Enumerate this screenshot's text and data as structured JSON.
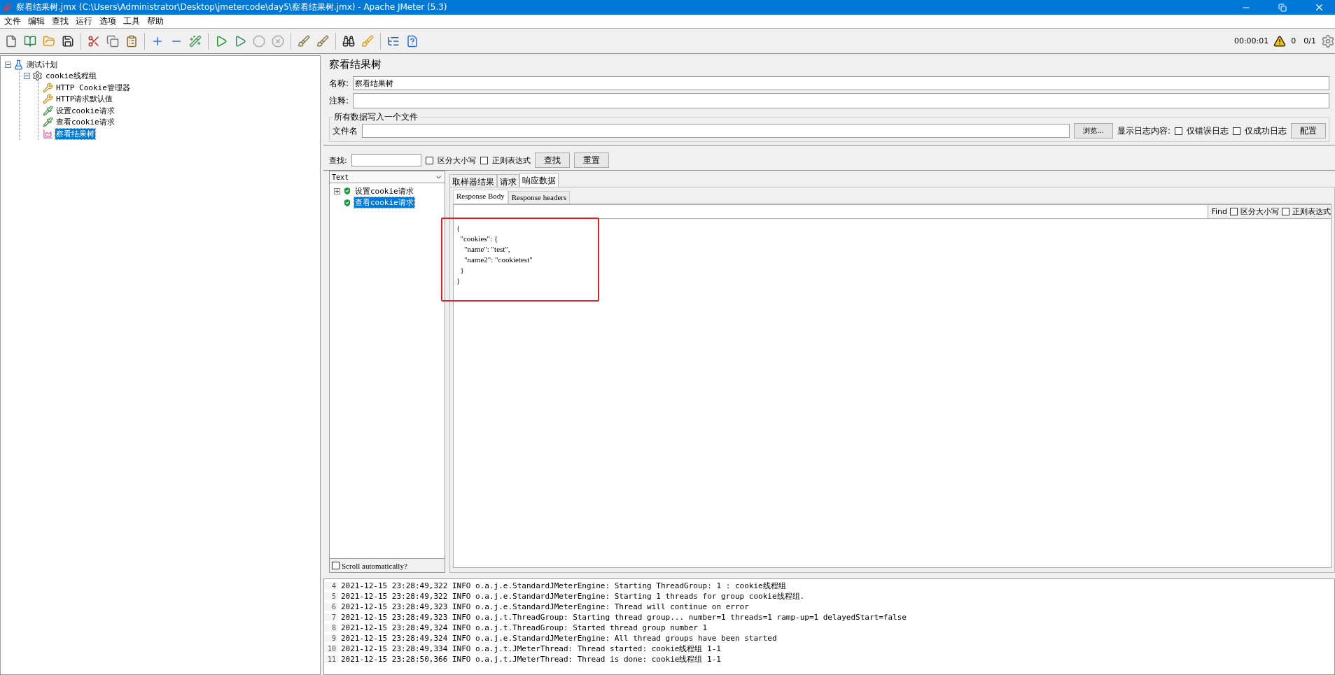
{
  "window": {
    "title": "察看结果树.jmx (C:\\Users\\Administrator\\Desktop\\jmetercode\\day5\\察看结果树.jmx) - Apache JMeter (5.3)"
  },
  "menu": [
    "文件",
    "编辑",
    "查找",
    "运行",
    "选项",
    "工具",
    "帮助"
  ],
  "status": {
    "elapsed": "00:00:01",
    "warnings": "0",
    "threads": "0/1"
  },
  "tree": [
    {
      "label": "测试计划",
      "kind": "plan",
      "expanded": true,
      "selected": false,
      "children": [
        {
          "label": "cookie线程组",
          "kind": "thread-group",
          "expanded": true,
          "selected": false,
          "children": [
            {
              "label": "HTTP Cookie管理器",
              "kind": "config",
              "selected": false
            },
            {
              "label": "HTTP请求默认值",
              "kind": "config",
              "selected": false
            },
            {
              "label": "设置cookie请求",
              "kind": "sampler",
              "selected": false
            },
            {
              "label": "查看cookie请求",
              "kind": "sampler",
              "selected": false
            },
            {
              "label": "察看结果树",
              "kind": "listener",
              "selected": true
            }
          ]
        }
      ]
    }
  ],
  "editor": {
    "title": "察看结果树",
    "name_label": "名称:",
    "name_value": "察看结果树",
    "comment_label": "注释:",
    "file_section": {
      "title": "所有数据写入一个文件",
      "file_label": "文件名",
      "browse_button": "浏览...",
      "log_label": "显示日志内容:",
      "options": [
        {
          "label": "仅错误日志",
          "checked": false
        },
        {
          "label": "仅成功日志",
          "checked": false
        }
      ],
      "config_button": "配置"
    },
    "search": {
      "label": "查找:",
      "options": [
        {
          "label": "区分大小写",
          "checked": false
        },
        {
          "label": "正则表达式",
          "checked": false
        }
      ],
      "find_button": "查找",
      "reset_button": "重置"
    }
  },
  "results": {
    "renderer": "Text",
    "samples": [
      {
        "label": "设置cookie请求",
        "kind": "group",
        "expanded": false,
        "selected": false
      },
      {
        "label": "查看cookie请求",
        "kind": "leaf",
        "selected": true
      }
    ],
    "scroll_automatically": {
      "label": "Scroll automatically?",
      "checked": false
    },
    "tabs": [
      {
        "label": "取样器结果",
        "selected": false
      },
      {
        "label": "请求",
        "selected": false
      },
      {
        "label": "响应数据",
        "selected": true
      }
    ],
    "subtabs": [
      {
        "label": "Response Body",
        "selected": true
      },
      {
        "label": "Response headers",
        "selected": false
      }
    ],
    "find": {
      "label": "Find",
      "options": [
        {
          "label": "区分大小写",
          "checked": false
        },
        {
          "label": "正则表达式",
          "checked": false
        }
      ]
    },
    "body": [
      "{",
      "  \"cookies\": {",
      "    \"name\": \"test\",",
      "    \"name2\": \"cookietest\"",
      "  }",
      "}"
    ]
  },
  "log": [
    {
      "number": "4",
      "text": "2021-12-15 23:28:49,322 INFO o.a.j.e.StandardJMeterEngine: Starting ThreadGroup: 1 : cookie线程组"
    },
    {
      "number": "5",
      "text": "2021-12-15 23:28:49,322 INFO o.a.j.e.StandardJMeterEngine: Starting 1 threads for group cookie线程组."
    },
    {
      "number": "6",
      "text": "2021-12-15 23:28:49,323 INFO o.a.j.e.StandardJMeterEngine: Thread will continue on error"
    },
    {
      "number": "7",
      "text": "2021-12-15 23:28:49,323 INFO o.a.j.t.ThreadGroup: Starting thread group... number=1 threads=1 ramp-up=1 delayedStart=false"
    },
    {
      "number": "8",
      "text": "2021-12-15 23:28:49,324 INFO o.a.j.t.ThreadGroup: Started thread group number 1"
    },
    {
      "number": "9",
      "text": "2021-12-15 23:28:49,324 INFO o.a.j.e.StandardJMeterEngine: All thread groups have been started"
    },
    {
      "number": "10",
      "text": "2021-12-15 23:28:49,334 INFO o.a.j.t.JMeterThread: Thread started: cookie线程组 1-1"
    },
    {
      "number": "11",
      "text": "2021-12-15 23:28:50,366 INFO o.a.j.t.JMeterThread: Thread is done: cookie线程组 1-1"
    }
  ]
}
